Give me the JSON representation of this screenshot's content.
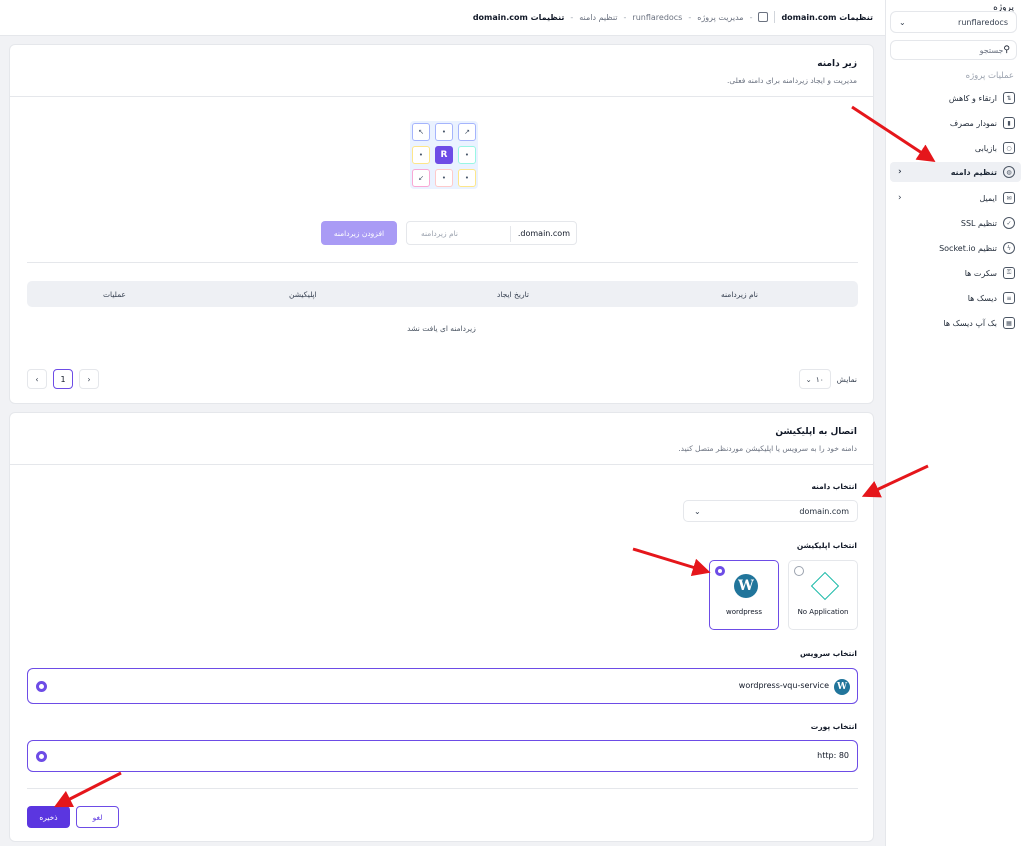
{
  "sidebar": {
    "project_label": "پروژه",
    "project_select": "runflaredocs",
    "search_placeholder": "جستجو",
    "section_title": "عملیات پروژه",
    "items": [
      {
        "label": "ارتقاء و کاهش",
        "icon": "upgrade-icon"
      },
      {
        "label": "نمودار مصرف",
        "icon": "chart-icon"
      },
      {
        "label": "بازیابی",
        "icon": "restore-icon"
      },
      {
        "label": "تنظیم دامنه",
        "icon": "globe-icon",
        "active": true
      },
      {
        "label": "ایمیل",
        "icon": "mail-icon"
      },
      {
        "label": "تنظیم SSL",
        "icon": "shield-check-icon"
      },
      {
        "label": "تنظیم Socket.io",
        "icon": "socket-icon"
      },
      {
        "label": "سکرت ها",
        "icon": "key-icon"
      },
      {
        "label": "دیسک ها",
        "icon": "disk-icon"
      },
      {
        "label": "بک آپ دیسک ها",
        "icon": "backup-icon"
      }
    ]
  },
  "topbar": {
    "title": "تنظیمات domain.com",
    "crumb1": "مدیریت پروژه",
    "crumb2": "runflaredocs",
    "crumb3": "تنظیم دامنه",
    "crumb4": "تنظیمات domain.com"
  },
  "subdomain": {
    "title": "زیر دامنه",
    "subtitle": "مدیریت و ایجاد زیردامنه برای دامنه فعلی.",
    "domain_suffix": ".domain.com",
    "input_placeholder": "نام زیردامنه",
    "add_button": "افزودن زیردامنه",
    "columns": [
      "نام زیردامنه",
      "تاریخ ایجاد",
      "اپلیکیشن",
      "عملیات"
    ],
    "empty_text": "زیردامنه ای یافت نشد",
    "show_label": "نمایش",
    "per_page": "۱۰",
    "current_page": "1",
    "illustration_letter": "R"
  },
  "connect": {
    "title": "اتصال به اپلیکیشن",
    "subtitle": "دامنه خود را به سرویس یا اپلیکیشن موردنظر متصل کنید.",
    "domain_label": "انتخاب دامنه",
    "domain_value": "domain.com",
    "app_label": "انتخاب اپلیکیشن",
    "apps": [
      {
        "name": "No Application",
        "selected": false
      },
      {
        "name": "wordpress",
        "selected": true
      }
    ],
    "service_label": "انتخاب سرویس",
    "service_value": "wordpress-vqu-service",
    "port_label": "انتخاب پورت",
    "port_value": "http: 80",
    "save_button": "ذخیره",
    "cancel_button": "لغو"
  },
  "colors": {
    "accent": "#6d4ce6",
    "annotation": "#e5161b"
  }
}
